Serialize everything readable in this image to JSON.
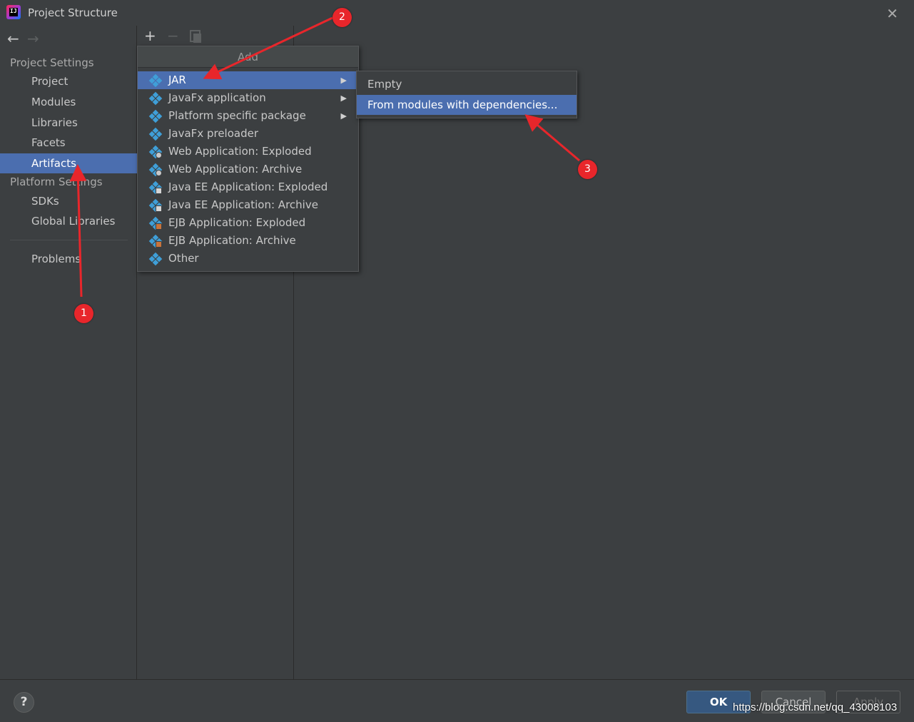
{
  "window": {
    "title": "Project Structure",
    "app_icon_text": "IJ"
  },
  "sidebar": {
    "project_settings_title": "Project Settings",
    "project_settings_items": [
      "Project",
      "Modules",
      "Libraries",
      "Facets",
      "Artifacts"
    ],
    "platform_settings_title": "Platform Settings",
    "platform_settings_items": [
      "SDKs",
      "Global Libraries"
    ],
    "problems_label": "Problems",
    "selected": "Artifacts"
  },
  "toolbar": {
    "add": "+",
    "remove": "−"
  },
  "add_menu": {
    "header": "Add",
    "items": [
      {
        "label": "JAR",
        "has_submenu": true,
        "selected": true,
        "icon": "jar-icon"
      },
      {
        "label": "JavaFx application",
        "has_submenu": true,
        "icon": "javafx-icon"
      },
      {
        "label": "Platform specific package",
        "has_submenu": true,
        "icon": "package-icon"
      },
      {
        "label": "JavaFx preloader",
        "has_submenu": false,
        "icon": "javafx-preloader-icon"
      },
      {
        "label": "Web Application: Exploded",
        "has_submenu": false,
        "icon": "web-icon"
      },
      {
        "label": "Web Application: Archive",
        "has_submenu": false,
        "icon": "web-icon"
      },
      {
        "label": "Java EE Application: Exploded",
        "has_submenu": false,
        "icon": "javaee-icon"
      },
      {
        "label": "Java EE Application: Archive",
        "has_submenu": false,
        "icon": "javaee-icon"
      },
      {
        "label": "EJB Application: Exploded",
        "has_submenu": false,
        "icon": "ejb-icon"
      },
      {
        "label": "EJB Application: Archive",
        "has_submenu": false,
        "icon": "ejb-icon"
      },
      {
        "label": "Other",
        "has_submenu": false,
        "icon": "other-icon"
      }
    ]
  },
  "jar_submenu": {
    "items": [
      {
        "label": "Empty",
        "selected": false
      },
      {
        "label": "From modules with dependencies...",
        "selected": true
      }
    ]
  },
  "footer": {
    "help": "?",
    "ok": "OK",
    "cancel": "Cancel",
    "apply": "Apply",
    "watermark": "https://blog.csdn.net/qq_43008103"
  },
  "annotations": {
    "badge_1": "1",
    "badge_2": "2",
    "badge_3": "3"
  },
  "colors": {
    "background": "#3c3f41",
    "selection": "#4b6eaf",
    "annotation_red": "#e8262b",
    "ok_button": "#365880",
    "artifact_icon": "#3f9fd8"
  }
}
